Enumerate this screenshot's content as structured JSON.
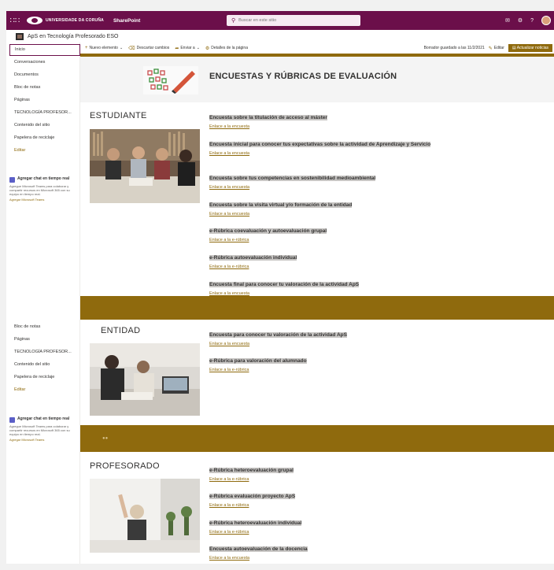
{
  "suite_bar": {
    "org_name": "UNIVERSIDADE DA CORUÑA",
    "app_name": "SharePoint",
    "search_placeholder": "Buscar en este sitio",
    "colors": {
      "bar": "#6b0f4a",
      "accent": "#8f6a0d"
    }
  },
  "site": {
    "title": "ApS en Tecnología Profesorado ESO"
  },
  "nav": {
    "home": "Inicio",
    "items_top": [
      "Conversaciones",
      "Documentos",
      "Bloc de notas",
      "Páginas",
      "TECNOLOGÍA PROFESOR...",
      "Contenido del sitio",
      "Papelera de reciclaje"
    ],
    "edit": "Editar",
    "items_bottom": [
      "Bloc de notas",
      "Páginas",
      "TECNOLOGÍA PROFESOR...",
      "Contenido del sitio",
      "Papelera de reciclaje"
    ],
    "teams_title": "Agregar chat en tiempo real",
    "teams_desc": "Agregue Microsoft Teams para colaborar y compartir recursos en Microsoft 365 con su equipo en tiempo real.",
    "teams_link": "Agregar Microsoft Teams"
  },
  "command_bar": {
    "new": "Nuevo elemento",
    "discard": "Descartar cambios",
    "send": "Enviar a",
    "details": "Detalles de la página",
    "saved": "Borrador guardado a las 11/2/2021",
    "edit": "Editar",
    "publish": "Actualizar noticias"
  },
  "page": {
    "banner_title": "ENCUESTAS Y RÚBRICAS DE EVALUACIÓN",
    "sections": [
      {
        "title": "ESTUDIANTE",
        "surveys": [
          {
            "title": "Encuesta sobre la titulación de acceso al máster",
            "link": "Enlace a la encuesta"
          },
          {
            "title": "Encuesta inicial para conocer tus expectativas sobre la actividad de Aprendizaje y Servicio",
            "link": "Enlace a la encuesta"
          },
          {
            "title": "Encuesta sobre tus competencias en sostenibilidad medioambiental",
            "link": "Enlace a la encuesta"
          },
          {
            "title": "Encuesta sobre la visita virtual y/o formación de la entidad",
            "link": "Enlace a la encuesta"
          },
          {
            "title": "e-Rúbrica coevaluación y autoevaluación grupal",
            "link": "Enlace a la e-rúbrica"
          },
          {
            "title": "e-Rúbrica autoevaluación individual",
            "link": "Enlace a la e-rúbrica"
          },
          {
            "title": "Encuesta final para conocer tu valoración de la actividad ApS",
            "link": "Enlace a la encuesta"
          }
        ]
      },
      {
        "title": "ENTIDAD",
        "surveys": [
          {
            "title": "Encuesta para conocer tu valoración de la actividad ApS",
            "link": "Enlace a la encuesta"
          },
          {
            "title": "e-Rúbrica para valoración del alumnado",
            "link": "Enlace a la e-rúbrica"
          }
        ]
      },
      {
        "title": "PROFESORADO",
        "surveys": [
          {
            "title": "e-Rúbrica heteroevaluación grupal",
            "link": "Enlace a la e-rúbrica"
          },
          {
            "title": "e-Rúbrica evaluación proyecto ApS",
            "link": "Enlace a la e-rúbrica"
          },
          {
            "title": "e-Rúbrica heteroevaluación individual",
            "link": "Enlace a la e-rúbrica"
          },
          {
            "title": "Encuesta autoevaluación de la docencia",
            "link": "Enlace a la encuesta"
          }
        ]
      }
    ]
  }
}
